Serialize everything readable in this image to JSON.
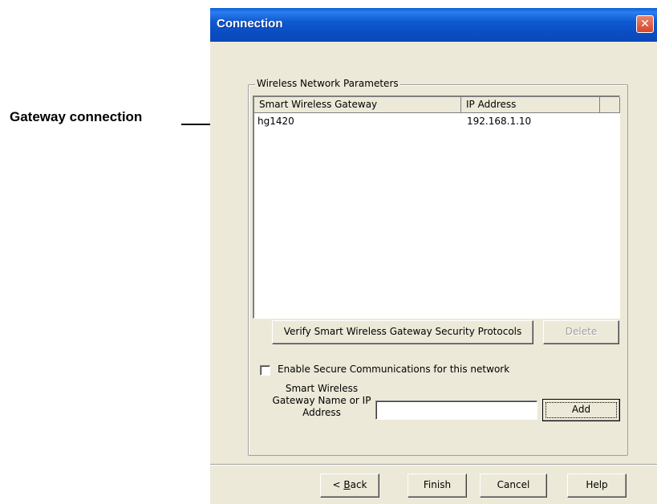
{
  "annotation": {
    "label": "Gateway connection"
  },
  "window": {
    "title": "Connection",
    "close_icon": "close-icon"
  },
  "group": {
    "label": "Wireless Network Parameters",
    "columns": [
      "Smart Wireless Gateway",
      "IP Address"
    ],
    "rows": [
      {
        "gateway": "hg1420",
        "ip": "192.168.1.10"
      }
    ],
    "verify_button": "Verify Smart Wireless Gateway Security Protocols",
    "delete_button": "Delete",
    "secure_checkbox": {
      "label": "Enable Secure Communications for this network",
      "checked": false
    },
    "name_field": {
      "label_line1": "Smart Wireless",
      "label_line2": "Gateway Name or IP",
      "label_line3": "Address",
      "value": ""
    },
    "add_button": "Add"
  },
  "footer": {
    "back_prefix": "< ",
    "back_accel": "B",
    "back_rest": "ack",
    "finish": "Finish",
    "cancel": "Cancel",
    "help": "Help"
  }
}
